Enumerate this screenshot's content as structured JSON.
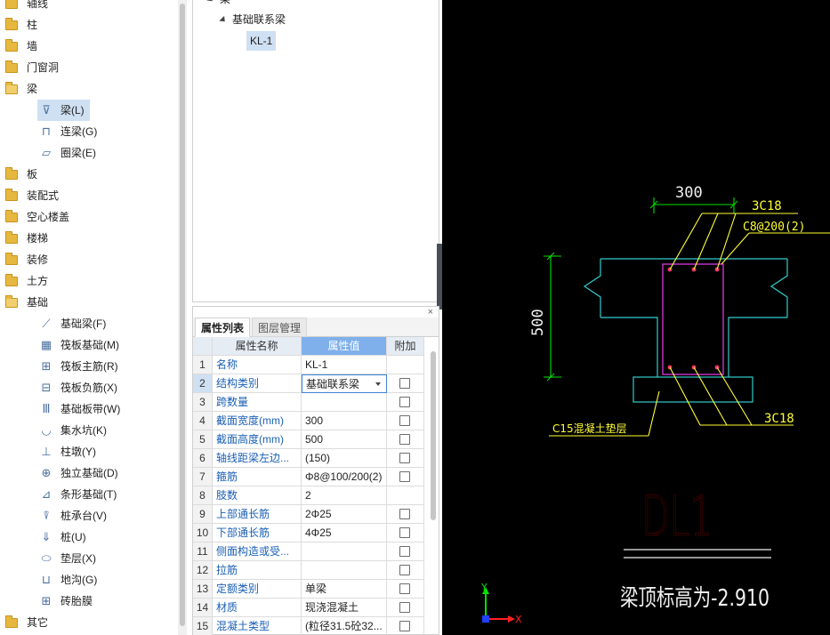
{
  "nav": {
    "top_items": [
      {
        "label": "轴线"
      },
      {
        "label": "柱"
      },
      {
        "label": "墙"
      },
      {
        "label": "门窗洞"
      },
      {
        "label": "梁"
      },
      {
        "label": "板"
      },
      {
        "label": "装配式"
      },
      {
        "label": "空心楼盖"
      },
      {
        "label": "楼梯"
      },
      {
        "label": "装修"
      },
      {
        "label": "土方"
      },
      {
        "label": "基础"
      },
      {
        "label": "其它"
      }
    ],
    "beam_children": [
      {
        "label": "梁(L)",
        "icon": "beam-icon",
        "glyph": "⊽"
      },
      {
        "label": "连梁(G)",
        "icon": "coupling-beam-icon",
        "glyph": "⊓"
      },
      {
        "label": "圈梁(E)",
        "icon": "ring-beam-icon",
        "glyph": "▱"
      }
    ],
    "foundation_children": [
      {
        "label": "基础梁(F)",
        "icon": "foundation-beam-icon",
        "glyph": "⟋"
      },
      {
        "label": "筏板基础(M)",
        "icon": "raft-foundation-icon",
        "glyph": "▦"
      },
      {
        "label": "筏板主筋(R)",
        "icon": "raft-main-rebar-icon",
        "glyph": "⊞"
      },
      {
        "label": "筏板负筋(X)",
        "icon": "raft-negative-rebar-icon",
        "glyph": "⊟"
      },
      {
        "label": "基础板带(W)",
        "icon": "foundation-strip-icon",
        "glyph": "Ⅲ"
      },
      {
        "label": "集水坑(K)",
        "icon": "sump-pit-icon",
        "glyph": "◡"
      },
      {
        "label": "柱墩(Y)",
        "icon": "column-pier-icon",
        "glyph": "⊥"
      },
      {
        "label": "独立基础(D)",
        "icon": "isolated-footing-icon",
        "glyph": "⊕"
      },
      {
        "label": "条形基础(T)",
        "icon": "strip-footing-icon",
        "glyph": "⊿"
      },
      {
        "label": "桩承台(V)",
        "icon": "pile-cap-icon",
        "glyph": "⍒"
      },
      {
        "label": "桩(U)",
        "icon": "pile-icon",
        "glyph": "⇓"
      },
      {
        "label": "垫层(X)",
        "icon": "cushion-icon",
        "glyph": "⬭"
      },
      {
        "label": "地沟(G)",
        "icon": "trench-icon",
        "glyph": "⊔"
      },
      {
        "label": "砖胎膜",
        "icon": "brick-formwork-icon",
        "glyph": "⊞"
      }
    ]
  },
  "component_tree": {
    "root": "梁",
    "group": "基础联系梁",
    "item": "KL-1"
  },
  "props": {
    "close_glyph": "×",
    "tab_properties": "属性列表",
    "tab_layers": "图层管理",
    "header": {
      "name": "属性名称",
      "value": "属性值",
      "extra": "附加"
    },
    "rows": [
      {
        "no": "1",
        "name": "名称",
        "value": "KL-1",
        "check": false
      },
      {
        "no": "2",
        "name": "结构类别",
        "value": "基础联系梁",
        "check": true,
        "selected": true
      },
      {
        "no": "3",
        "name": "跨数量",
        "value": "",
        "check": true
      },
      {
        "no": "4",
        "name": "截面宽度(mm)",
        "value": "300",
        "check": true
      },
      {
        "no": "5",
        "name": "截面高度(mm)",
        "value": "500",
        "check": true
      },
      {
        "no": "6",
        "name": "轴线距梁左边...",
        "value": "(150)",
        "check": true
      },
      {
        "no": "7",
        "name": "箍筋",
        "value": "Φ8@100/200(2)",
        "check": true
      },
      {
        "no": "8",
        "name": "肢数",
        "value": "2",
        "check": false
      },
      {
        "no": "9",
        "name": "上部通长筋",
        "value": "2Φ25",
        "check": true
      },
      {
        "no": "10",
        "name": "下部通长筋",
        "value": "4Φ25",
        "check": true
      },
      {
        "no": "11",
        "name": "侧面构造或受...",
        "value": "",
        "check": true
      },
      {
        "no": "12",
        "name": "拉筋",
        "value": "",
        "check": true
      },
      {
        "no": "13",
        "name": "定额类别",
        "value": "单梁",
        "check": true
      },
      {
        "no": "14",
        "name": "材质",
        "value": "现浇混凝土",
        "check": true
      },
      {
        "no": "15",
        "name": "混凝土类型",
        "value": "(粒径31.5砼32...",
        "check": true
      }
    ]
  },
  "cad": {
    "dim_width": "300",
    "dim_height": "500",
    "top_bars": "3C18",
    "stirrups": "C8@200(2)",
    "bottom_bars": "3C18",
    "cushion": "C15混凝土垫层",
    "title": "DL1",
    "elevation": "梁顶标高为-2.910",
    "axis_x": "X",
    "axis_y": "Y",
    "colors": {
      "green": "#00e000",
      "cyan": "#33cccc",
      "magenta": "#cc33cc",
      "yellow": "#ffff33",
      "red": "#e00000",
      "white": "#f0f0f0",
      "blue": "#2040ff"
    }
  }
}
